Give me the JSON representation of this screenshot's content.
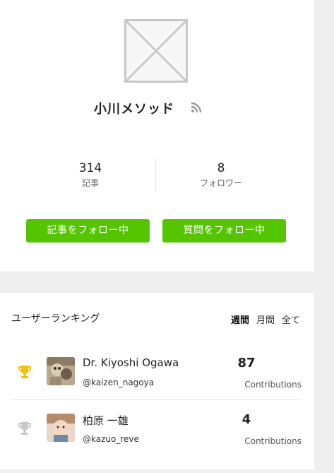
{
  "profile": {
    "name": "小川メソッド",
    "stats": [
      {
        "value": "314",
        "label": "記事"
      },
      {
        "value": "8",
        "label": "フォロワー"
      }
    ],
    "follow_articles_label": "記事をフォロー中",
    "follow_questions_label": "質問をフォロー中"
  },
  "ranking": {
    "title": "ユーザーランキング",
    "tabs": [
      "週間",
      "月間",
      "全て"
    ],
    "active_tab": "週間",
    "rows": [
      {
        "name": "Dr. Kiyoshi Ogawa",
        "id": "@kaizen_nagoya",
        "count": "87",
        "count_label": "Contributions",
        "trophy": "gold"
      },
      {
        "name": "柏原 一雄",
        "id": "@kazuo_reve",
        "count": "4",
        "count_label": "Contributions",
        "trophy": "silver"
      }
    ]
  },
  "colors": {
    "accent_green": "#55c500",
    "trophy_gold": "#f5c000",
    "trophy_silver": "#c8c8c8"
  },
  "icons": {
    "avatar_placeholder": "image-placeholder-icon",
    "rss": "rss-icon",
    "trophy": "trophy-icon"
  }
}
